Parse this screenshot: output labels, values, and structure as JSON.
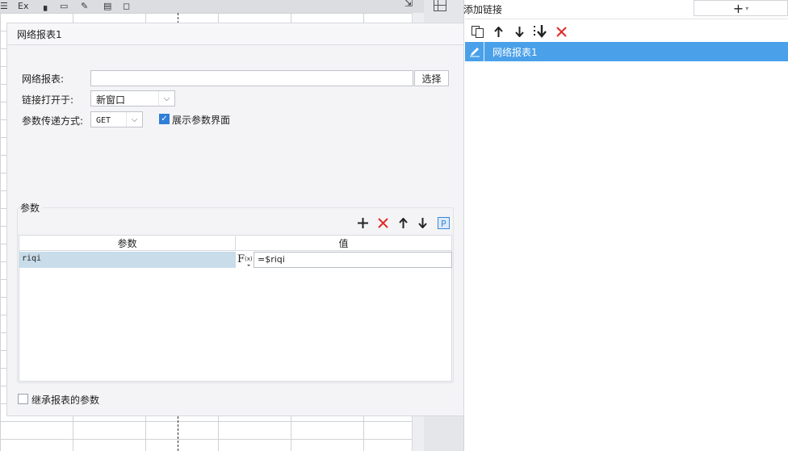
{
  "dialog": {
    "title": "网络报表1",
    "report_label": "网络报表:",
    "report_value": "",
    "select_button": "选择",
    "open_in_label": "链接打开于:",
    "open_in_value": "新窗口",
    "method_label": "参数传递方式:",
    "method_value": "GET",
    "show_params_label": "展示参数界面",
    "show_params_checked": true,
    "params": {
      "group_title": "参数",
      "col_param": "参数",
      "col_value": "值",
      "rows": [
        {
          "param": "riqi",
          "fx": "F(x)",
          "value": "=$riqi"
        }
      ]
    },
    "inherit_label": "继承报表的参数",
    "inherit_checked": false
  },
  "right_panel": {
    "title": "添加链接",
    "add_button": "+",
    "links": [
      {
        "label": "网络报表1",
        "selected": true
      }
    ]
  },
  "background": {
    "toolbar_text": "Ex"
  },
  "colors": {
    "selected_item": "#4aa0e9",
    "delete_red": "#e02b2b",
    "param_cell_bg": "#c8dce9",
    "checkbox_blue": "#2f7fd8"
  }
}
